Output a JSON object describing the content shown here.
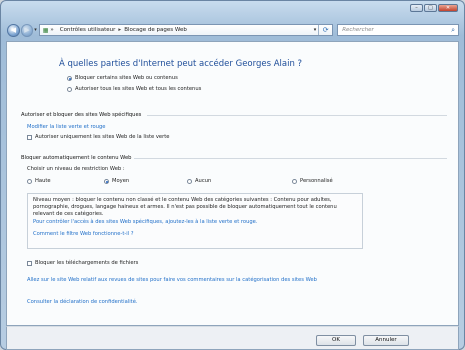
{
  "navbar": {
    "breadcrumb": [
      "Contrôles utilisateur",
      "Blocage de pages Web"
    ],
    "search_placeholder": "Rechercher"
  },
  "main": {
    "title": "À quelles parties d'Internet peut accéder Georges Alain ?",
    "radio_block": "Bloquer certains sites Web ou contenus",
    "radio_allow": "Autoriser tous les sites Web et tous les contenus",
    "specific": {
      "heading": "Autoriser et bloquer des sites Web spécifiques",
      "link": "Modifier la liste verte et rouge",
      "checkbox": "Autoriser uniquement les sites Web de la liste verte"
    },
    "auto": {
      "heading": "Bloquer automatiquement le contenu Web",
      "prompt": "Choisir un niveau de restriction Web :",
      "levels": [
        "Haute",
        "Moyen",
        "Aucun",
        "Personnalisé"
      ],
      "description": "Niveau moyen : bloquer le contenu non classé et le contenu Web des catégories suivantes : Contenu pour adultes, pornographie, drogues, langage haineux et armes. Il n'est pas possible de bloquer automatiquement tout le contenu relevant de ces catégories.",
      "link_control": "Pour contrôler l'accès à des sites Web spécifiques, ajoutez-les à la liste verte et rouge.",
      "link_how": "Comment le filtre Web fonctionne-t-il ?"
    },
    "downloads_checkbox": "Bloquer les téléchargements de fichiers",
    "link_feedback": "Allez sur le site Web relatif aux revues de sites pour faire vos commentaires sur la catégorisation des sites Web",
    "link_privacy": "Consulter la déclaration de confidentialité."
  },
  "footer": {
    "ok_label": "OK",
    "cancel_label": "Annuler"
  }
}
